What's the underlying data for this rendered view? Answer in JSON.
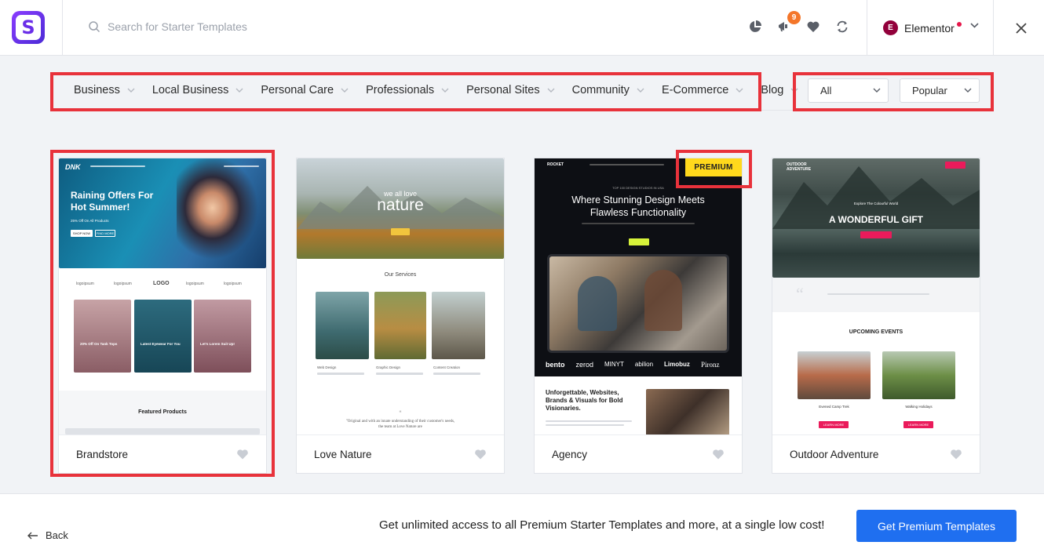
{
  "header": {
    "search_placeholder": "Search for Starter Templates",
    "notification_count": "9",
    "builder_label": "Elementor"
  },
  "categories": [
    {
      "label": "Business"
    },
    {
      "label": "Local Business"
    },
    {
      "label": "Personal Care"
    },
    {
      "label": "Professionals"
    },
    {
      "label": "Personal Sites"
    },
    {
      "label": "Community"
    },
    {
      "label": "E-Commerce"
    },
    {
      "label": "Blog"
    }
  ],
  "filters": {
    "type_value": "All",
    "sort_value": "Popular"
  },
  "cards": [
    {
      "name": "Brandstore"
    },
    {
      "name": "Love Nature"
    },
    {
      "name": "Agency",
      "badge": "PREMIUM"
    },
    {
      "name": "Outdoor Adventure"
    }
  ],
  "thumbs": {
    "brandstore": {
      "brand": "DNK",
      "hero_title": "Raining Offers For Hot Summer!",
      "hero_sub": "25% Off On All Products",
      "btn1": "SHOP NOW",
      "btn2": "FIND MORE",
      "logos": [
        "logoipsum",
        "logoipsum",
        "LOGO",
        "logoipsum",
        "logoipsum"
      ],
      "promo1": "20% Off On Tank Tops",
      "promo2": "Latest Eyewear For You",
      "promo3": "Let's Lorem Suit Up!",
      "section": "Featured Products"
    },
    "nature": {
      "kicker": "we all love",
      "title": "nature",
      "section": "Our Services",
      "s1": "Web Design",
      "s2": "Graphic Design",
      "s3": "Content Creation",
      "quote": "\"Original and with an innate understanding of their customer's needs, the team at Love Nature are"
    },
    "agency": {
      "brand": "ROCKET",
      "kicker": "TOP 100 DESIGN STUDIOS IN USA",
      "title": "Where Stunning Design Meets Flawless Functionality",
      "clients": [
        "bento",
        "zerod",
        "MINYT",
        "abilion",
        "Limobuz",
        "Pironz"
      ],
      "sub": "Unforgettable, Websites, Brands & Visuals for Bold Visionaries."
    },
    "outdoor": {
      "brand": "OUTDOOR ADVENTURE",
      "kicker": "Explore The Colourful World",
      "title": "A WONDERFUL GIFT",
      "section": "UPCOMING EVENTS",
      "e1": "Evened Camp Trek",
      "e2": "Walking Holidays",
      "btn": "LEARN MORE"
    }
  },
  "bottom": {
    "back_label": "Back",
    "promo_text": "Get unlimited access to all Premium Starter Templates and more, at a single low cost!",
    "cta_label": "Get Premium Templates"
  },
  "colors": {
    "accent": "#1f6ff0",
    "highlight": "#e8323b",
    "premium": "#ffd91c"
  }
}
